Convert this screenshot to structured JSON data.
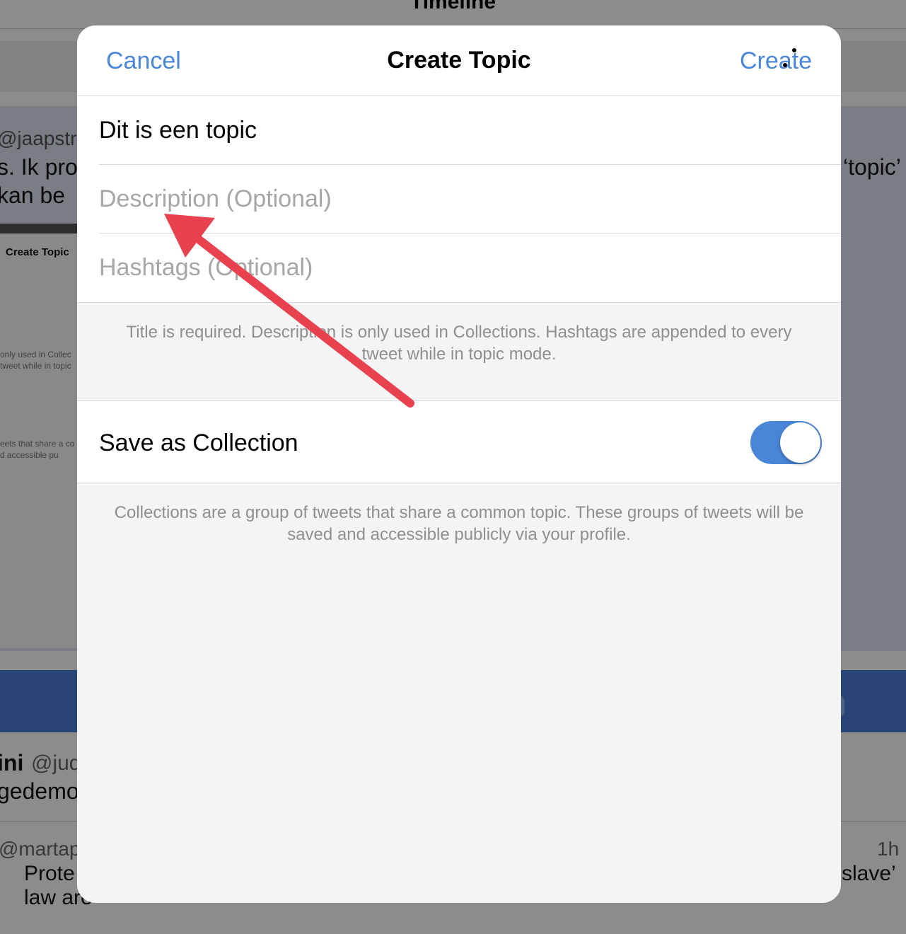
{
  "background": {
    "title": "Timeline",
    "fragments": {
      "handle1": "@jaapstro",
      "line1_left": "s. Ik pro",
      "line1_right": "‘topic’",
      "line2_left": " kan be",
      "inner_title": "Create Topic",
      "inner_note1a": "only used in Collec",
      "inner_note1b": "tweet while in topic",
      "inner_note2a": "eets that share a co",
      "inner_note2b": "d accessible pu",
      "name2": "ini",
      "handle2": "@jud",
      "line3_left": "gedemo",
      "handle3": "@martapa",
      "time3": "1h",
      "line4_left": "Prote",
      "line4_right": "slave’",
      "line5_left": "law are"
    }
  },
  "modal": {
    "nav": {
      "cancel_label": "Cancel",
      "title": "Create Topic",
      "create_label": "Create"
    },
    "fields": {
      "title_value": "Dit is een topic",
      "description_placeholder": "Description (Optional)",
      "hashtags_placeholder": "Hashtags (Optional)"
    },
    "note_fields": "Title is required. Description is only used in Collections. Hashtags are appended to every tweet while in topic mode.",
    "save_collection": {
      "label": "Save as Collection",
      "enabled": true
    },
    "note_collection": "Collections are a group of tweets that share a common topic. These groups of tweets will be saved and accessible publicly via your profile."
  },
  "colors": {
    "accent": "#4a86d8",
    "annotation_arrow": "#e8424f"
  }
}
